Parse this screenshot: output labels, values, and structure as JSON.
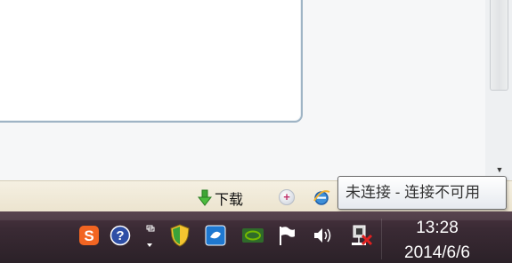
{
  "status_bar": {
    "download_label": "下载",
    "connection_tooltip": "未连接 - 连接不可用"
  },
  "system_tray": {
    "icons": [
      "sogou-input-icon",
      "help-icon",
      "ime-mode-icon",
      "security-shield-icon",
      "app-icon",
      "nvidia-icon",
      "action-center-flag-icon",
      "volume-icon",
      "network-disconnected-icon"
    ],
    "time": "13:28",
    "date": "2014/6/6"
  },
  "colors": {
    "taskbar": "#3a2a34",
    "status_bar": "#f0e9d7",
    "sogou_orange": "#f26522",
    "disconnected_red": "#e02020"
  }
}
